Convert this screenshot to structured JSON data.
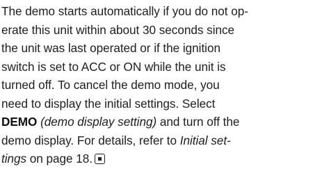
{
  "paragraph": {
    "line1": "The demo starts automatically if you do not op-",
    "line2": "erate this unit within about 30 seconds since",
    "line3": "the unit was last operated or if the ignition",
    "line4": "switch is set to ACC or ON while the unit is",
    "line5": "turned off. To cancel the demo mode, you",
    "line6": "need to display the initial settings. Select",
    "line7_bold": "DEMO",
    "line7_italic": "(demo display setting)",
    "line7_rest": " and turn off the",
    "line8": "demo display. For details, refer to ",
    "line8_italic": "Initial set-",
    "line9_italic": "tings",
    "line9_rest": " on page 18."
  },
  "end_icon": "end-of-section-icon"
}
